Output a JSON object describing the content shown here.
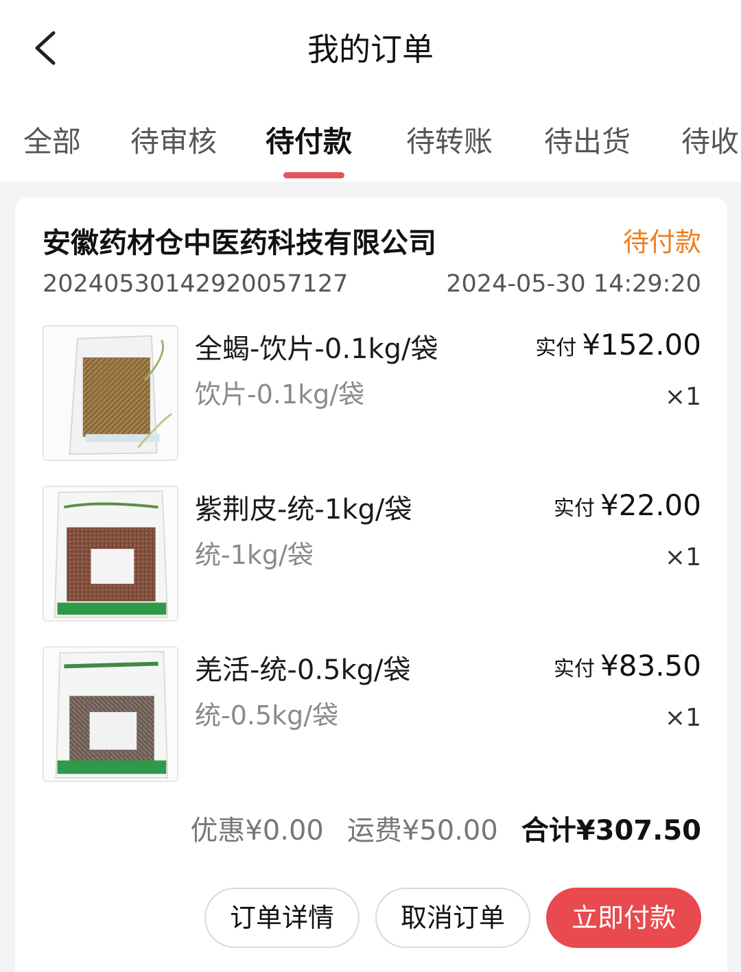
{
  "header": {
    "title": "我的订单"
  },
  "tabs": [
    {
      "label": "全部"
    },
    {
      "label": "待审核"
    },
    {
      "label": "待付款"
    },
    {
      "label": "待转账"
    },
    {
      "label": "待出货"
    },
    {
      "label": "待收"
    }
  ],
  "active_tab": "待付款",
  "order": {
    "company": "安徽药材仓中医药科技有限公司",
    "status": "待付款",
    "order_no": "20240530142920057127",
    "time": "2024-05-30 14:29:20",
    "items": [
      {
        "name": "全蝎-饮片-0.1kg/袋",
        "spec": "饮片-0.1kg/袋",
        "price_label": "实付",
        "price": "¥152.00",
        "qty": "×1"
      },
      {
        "name": "紫荆皮-统-1kg/袋",
        "spec": "统-1kg/袋",
        "price_label": "实付",
        "price": "¥22.00",
        "qty": "×1"
      },
      {
        "name": "羌活-统-0.5kg/袋",
        "spec": "统-0.5kg/袋",
        "price_label": "实付",
        "price": "¥83.50",
        "qty": "×1"
      }
    ],
    "summary": {
      "discount": "优惠¥0.00",
      "freight": "运费¥50.00",
      "total": "合计¥307.50"
    },
    "buttons": {
      "detail": "订单详情",
      "cancel": "取消订单",
      "pay": "立即付款"
    }
  },
  "colors": {
    "accent": "#e84a4f",
    "status": "#f07d1f",
    "tab_underline": "#e8535a"
  }
}
